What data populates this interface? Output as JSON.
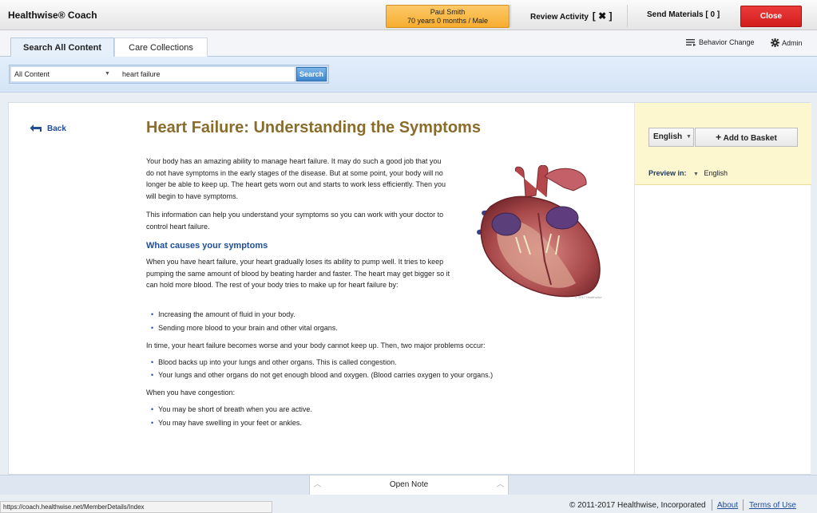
{
  "app": {
    "title": "Healthwise® Coach"
  },
  "patient": {
    "name": "Paul Smith",
    "details": "70 years 0 months / Male"
  },
  "topbar": {
    "review_label": "Review Activity",
    "review_value": "[ ✖ ]",
    "send_label": "Send Materials",
    "send_count": "[ 0 ]",
    "close_label": "Close"
  },
  "tabs": [
    {
      "label": "Search All Content",
      "active": true
    },
    {
      "label": "Care Collections",
      "active": false
    }
  ],
  "toolbar": {
    "behavior_label": "Behavior Change",
    "admin_label": "Admin"
  },
  "search": {
    "scope": "All Content",
    "query": "heart failure",
    "button": "Search"
  },
  "article": {
    "back_label": "Back",
    "title": "Heart Failure: Understanding the Symptoms",
    "intro1": "Your body has an amazing ability to manage heart failure. It may do such a good job that you do not have symptoms in the early stages of the disease. But at some point, your body will no longer be able to keep up. The heart gets worn out and starts to work less efficiently. Then you will begin to have symptoms.",
    "intro2": "This information can help you understand your symptoms so you can work with your doctor to control heart failure.",
    "section_heading": "What causes your symptoms",
    "section_p1": "When you have heart failure, your heart gradually loses its ability to pump well. It tries to keep pumping the same amount of blood by beating harder and faster. The heart may get bigger so it can hold more blood. The rest of your body tries to make up for heart failure by:",
    "bullets1": [
      "Increasing the amount of fluid in your body.",
      "Sending more blood to your brain and other vital organs."
    ],
    "section_p2": "In time, your heart failure becomes worse and your body cannot keep up. Then, two major problems occur:",
    "bullets2": [
      "Blood backs up into your lungs and other organs. This is called congestion.",
      "Your lungs and other organs do not get enough blood and oxygen. (Blood carries oxygen to your organs.)"
    ],
    "section_p3": "When you have congestion:",
    "bullets3": [
      "You may be short of breath when you are active.",
      "You may have swelling in your feet or ankles."
    ],
    "image_credit": "© 2017 Healthwise"
  },
  "sidebar": {
    "language": "English",
    "add_basket": "Add to Basket",
    "preview_label": "Preview in:",
    "preview_lang": "English"
  },
  "notebar": {
    "label": "Open Note"
  },
  "footer": {
    "status_url": "https://coach.healthwise.net/MemberDetails/Index",
    "copyright": "© 2011-2017 Healthwise, Incorporated",
    "about": "About",
    "terms": "Terms of Use"
  },
  "colors": {
    "close": "#d31c1c",
    "patient": "#f7ad2f",
    "title": "#8a6c2b",
    "link": "#1f4d9a",
    "sidebar_head": "#fdf7cf"
  }
}
